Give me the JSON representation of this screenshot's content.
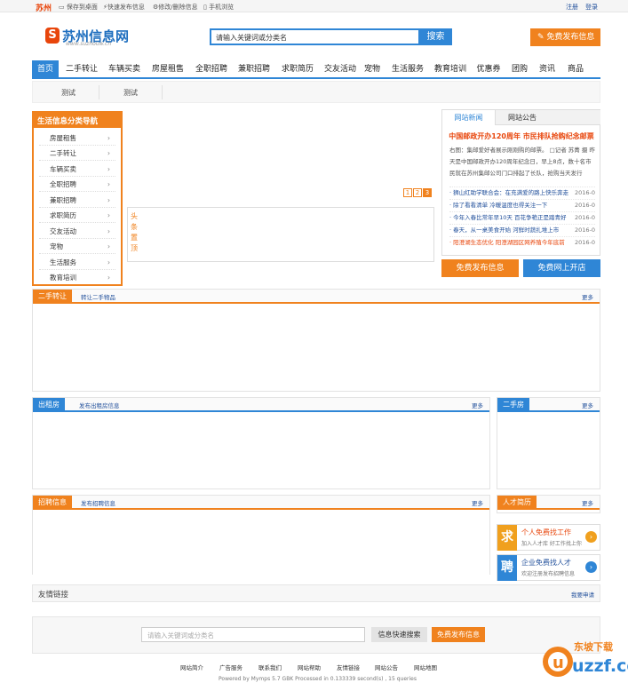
{
  "topbar": {
    "city": "苏州",
    "links": [
      "保存到桌面",
      "快速发布信息",
      "修改/删除信息",
      "手机浏览"
    ],
    "register": "注册",
    "login": "登录"
  },
  "header": {
    "logo_mark": "S",
    "logo_name": "苏州信息网",
    "logo_url": "www.suzhouw.cn",
    "search_placeholder": "请输入关键词或分类名",
    "search_button": "搜索",
    "post_button": "免费发布信息"
  },
  "nav": {
    "items": [
      "首页",
      "二手转让",
      "车辆买卖",
      "房屋租售",
      "全职招聘",
      "兼职招聘",
      "求职简历",
      "交友活动",
      "宠物",
      "生活服务",
      "教育培训",
      "优惠券",
      "团购",
      "资讯",
      "商品"
    ],
    "sub": [
      "测试",
      "测试"
    ]
  },
  "category": {
    "title": "生活信息分类导航",
    "items": [
      "房屋租售",
      "二手转让",
      "车辆买卖",
      "全职招聘",
      "兼职招聘",
      "求职简历",
      "交友活动",
      "宠物",
      "生活服务",
      "教育培训"
    ]
  },
  "slide": {
    "pages": [
      "1",
      "2",
      "3"
    ],
    "vertical_text": "头条置顶"
  },
  "news": {
    "tab_news": "网站新闻",
    "tab_notice": "网站公告",
    "headline": "中国邮政开办120周年 市民排队抢购纪念邮票",
    "summary": "右图：集邮爱好者展示刚刚购的邮票。  □记者  苏菁  摄 昨天是中国邮政开办120周年纪念日，早上8点，数十名市民就在苏州集邮公司门口排起了长队，抢购当天发行",
    "items": [
      {
        "title": "· 狮山红助学联合会：在充满爱的路上快乐奔走",
        "date": "2016-0",
        "red": false
      },
      {
        "title": "· 除了看看清单 冷暖温度也得关注一下",
        "date": "2016-0",
        "red": false
      },
      {
        "title": "· 今年入春比常年早10天 百花争艳正是踏青好",
        "date": "2016-0",
        "red": false
      },
      {
        "title": "· 春天，从一桌美食开始 河鲜时蔬扎堆上市",
        "date": "2016-0",
        "red": false
      },
      {
        "title": "· 阳澄湖生态优化 阳澄湖园区网养殖今年底前",
        "date": "2016-0",
        "red": true
      }
    ],
    "free_post": "免费发布信息",
    "free_shop": "免费网上开店"
  },
  "sections": {
    "secondhand": {
      "tag": "二手转让",
      "link": "转让二手物品",
      "more": "更多"
    },
    "rent": {
      "tag": "出租房",
      "link": "发布出租房信息",
      "more": "更多"
    },
    "used_house": {
      "tag": "二手房",
      "more": "更多"
    },
    "jobs": {
      "tag": "招聘信息",
      "link": "发布招聘信息",
      "more": "更多"
    },
    "talent": {
      "tag": "人才简历",
      "more": "更多"
    }
  },
  "ads": {
    "job": {
      "icon": "求",
      "title": "个人免费找工作",
      "sub": "加入人才库  好工作找上你"
    },
    "hire": {
      "icon": "聘",
      "title": "企业免费找人才",
      "sub": "欢迎注册发布招聘信息"
    }
  },
  "friend": {
    "title": "友情链接",
    "apply": "我要申请"
  },
  "bottom_search": {
    "placeholder": "请输入关键词或分类名",
    "quick_search": "信息快速搜索",
    "post": "免费发布信息"
  },
  "footer": {
    "links": [
      "网站简介",
      "广告服务",
      "联系我们",
      "网站帮助",
      "友情链接",
      "网站公告",
      "网站地图"
    ],
    "powered": "Powered by Mymps 5.7 GBK Processed in 0.133339 second(s) , 15 queries"
  },
  "watermark": {
    "text": "uzzf.com",
    "label": "东坡下载"
  },
  "colors": {
    "orange": "#f0821e",
    "blue": "#2f86d6",
    "red": "#e8450b"
  }
}
